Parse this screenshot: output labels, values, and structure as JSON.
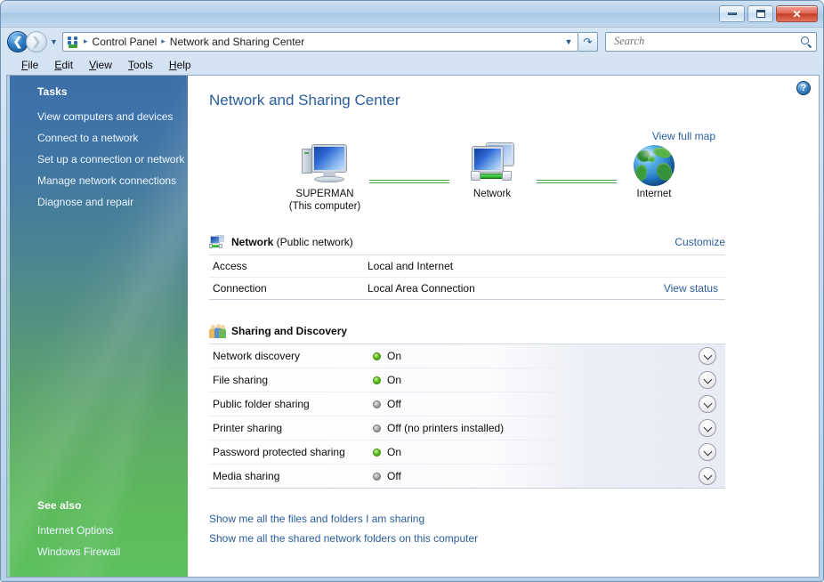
{
  "window": {
    "minimize_label": "Minimize",
    "maximize_label": "Maximize",
    "close_label": "Close"
  },
  "nav": {
    "back_label": "Back",
    "forward_label": "Forward",
    "history_label": "Recent pages",
    "refresh_label": "Refresh",
    "breadcrumbs": [
      "Control Panel",
      "Network and Sharing Center"
    ],
    "separator": "▸"
  },
  "search": {
    "value": "",
    "placeholder": "Search"
  },
  "menu": {
    "items": [
      {
        "pre": "",
        "accel": "F",
        "post": "ile"
      },
      {
        "pre": "",
        "accel": "E",
        "post": "dit"
      },
      {
        "pre": "",
        "accel": "V",
        "post": "iew"
      },
      {
        "pre": "",
        "accel": "T",
        "post": "ools"
      },
      {
        "pre": "",
        "accel": "H",
        "post": "elp"
      }
    ]
  },
  "sidebar": {
    "tasks_heading": "Tasks",
    "tasks": [
      "View computers and devices",
      "Connect to a network",
      "Set up a connection or network",
      "Manage network connections",
      "Diagnose and repair"
    ],
    "see_also_heading": "See also",
    "see_also": [
      "Internet Options",
      "Windows Firewall"
    ],
    "gradient_top": "#3d6fa8",
    "gradient_bottom": "#5cc05e"
  },
  "content": {
    "help_glyph": "?",
    "page_title": "Network and Sharing Center",
    "view_full_map": "View full map",
    "map": {
      "nodes": [
        {
          "name": "SUPERMAN",
          "sub": "(This computer)",
          "icon": "computer-icon"
        },
        {
          "name": "Network",
          "sub": "",
          "icon": "network-icon"
        },
        {
          "name": "Internet",
          "sub": "",
          "icon": "globe-icon"
        }
      ]
    },
    "network_panel": {
      "title_bold": "Network",
      "title_rest": " (Public network)",
      "customize_label": "Customize",
      "rows": [
        {
          "label": "Access",
          "value": "Local and Internet",
          "link": ""
        },
        {
          "label": "Connection",
          "value": "Local Area Connection",
          "link": "View status"
        }
      ]
    },
    "sharing_panel": {
      "title": "Sharing and Discovery",
      "rows": [
        {
          "label": "Network discovery",
          "state": "on",
          "value": "On"
        },
        {
          "label": "File sharing",
          "state": "on",
          "value": "On"
        },
        {
          "label": "Public folder sharing",
          "state": "off",
          "value": "Off"
        },
        {
          "label": "Printer sharing",
          "state": "off",
          "value": "Off (no printers installed)"
        },
        {
          "label": "Password protected sharing",
          "state": "on",
          "value": "On"
        },
        {
          "label": "Media sharing",
          "state": "off",
          "value": "Off"
        }
      ],
      "expand_label": "Expand"
    },
    "bottom_links": [
      "Show me all the files and folders I am sharing",
      "Show me all the shared network folders on this computer"
    ]
  },
  "colors": {
    "link": "#2a5d9c",
    "title": "#2a5d9c",
    "status_on": "#5cba1c",
    "status_off": "#8d8d8d",
    "connector_line": "#4a9a4a"
  }
}
